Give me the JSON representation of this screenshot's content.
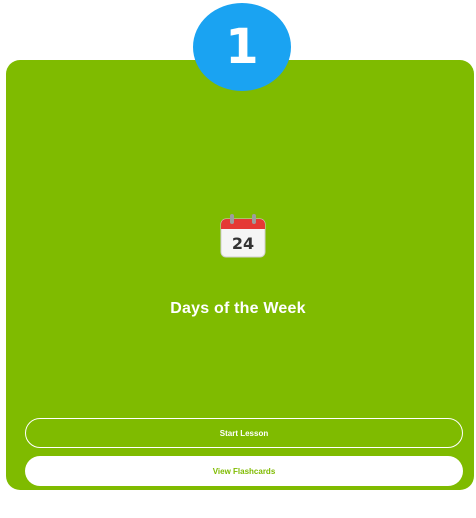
{
  "lesson": {
    "number": "1",
    "title": "Days of the Week",
    "icon": "calendar-icon",
    "icon_date": "24"
  },
  "actions": {
    "start_label": "Start Lesson",
    "flashcards_label": "View Flashcards"
  },
  "colors": {
    "card_background": "#7fbb00",
    "badge_background": "#1aa3f2",
    "text": "#ffffff",
    "calendar_header": "#e53935"
  }
}
